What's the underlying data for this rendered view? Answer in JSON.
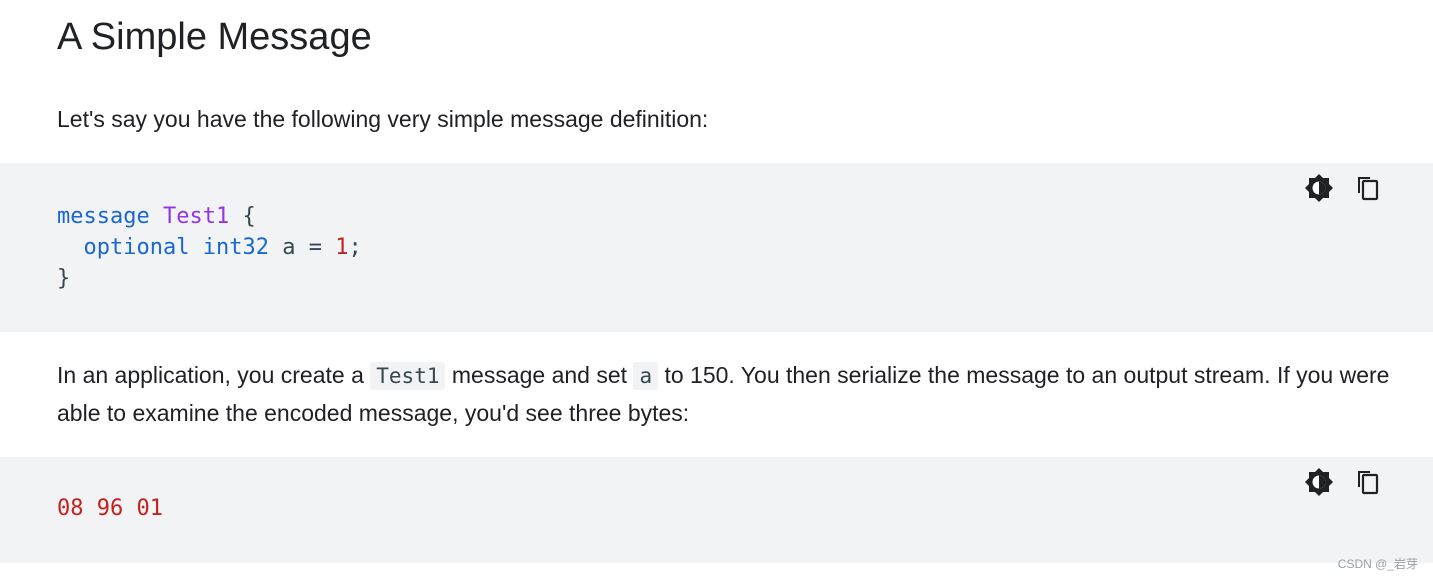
{
  "heading": "A Simple Message",
  "intro": "Let's say you have the following very simple message definition:",
  "code1": {
    "line1": {
      "kw": "message",
      "cls": "Test1",
      "brace": "{"
    },
    "line2": {
      "kw1": "optional",
      "kw2": "int32",
      "field": "a",
      "eq": "=",
      "num": "1",
      "semi": ";"
    },
    "line3": {
      "brace": "}"
    }
  },
  "para2": {
    "t1": "In an application, you create a ",
    "code_a": "Test1",
    "t2": " message and set ",
    "code_b": "a",
    "t3": " to 150. You then serialize the message to an output stream. If you were able to examine the encoded message, you'd see three bytes:"
  },
  "code2": "08 96 01",
  "icons": {
    "theme": "theme-toggle-icon",
    "copy": "copy-icon"
  },
  "colors": {
    "keyword": "#1967d2",
    "class_name": "#9334e6",
    "number": "#c5221f",
    "code_bg": "#f1f3f4"
  },
  "watermark": "CSDN @_岩芽"
}
